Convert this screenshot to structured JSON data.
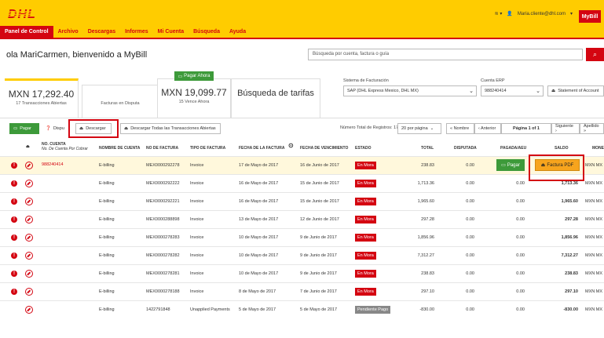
{
  "header": {
    "logo": "DHL",
    "user_email": "Maria.cliente@dhl.com",
    "mybill_label": "MyBill"
  },
  "nav": [
    "Panel de Control",
    "Archivo",
    "Descargas",
    "Informes",
    "Mi Cuenta",
    "Búsqueda",
    "Ayuda"
  ],
  "welcome": "ola MariCarmen, bienvenido a MyBill",
  "search": {
    "placeholder": "Búsqueda por cuenta, factura o guía"
  },
  "summary": {
    "open_amount": "MXN 17,292.40",
    "open_label": "17 Transacciones Abiertas",
    "disputed_label": "Facturas en Disputa",
    "due_amount": "MXN 19,099.77",
    "due_label": "15 Vence Ahora",
    "pay_now": "Pagar Ahora",
    "rates_search": "Búsqueda de tarifas"
  },
  "filters": {
    "billing_label": "Sistema de Facturación",
    "billing_value": "SAP (DHL Express Mexico, DHL MX)",
    "erp_label": "Cuenta ERP",
    "erp_value": "988240414",
    "statement": "Statement of Account"
  },
  "toolbar": {
    "pay": "Pagar",
    "dispute": "Dispu",
    "download": "Descargar",
    "download_all": "Descargar Todas las Transacciones Abiertas",
    "total_records": "Número Total de Registros: 17",
    "per_page": "20 por página",
    "first": "« Nombre",
    "prev": "‹ Anterior",
    "page": "Página 1 of 1",
    "next": "Siguiente ›",
    "last": "Apellido »"
  },
  "columns": {
    "account": "NO. CUENTA",
    "account_sub": "No. De Cuenta Por Cobrar",
    "client": "NOMBRE DE CUENTA",
    "invoice_no": "NO DE FACTURA",
    "invoice_type": "TIPO DE FACTURA",
    "invoice_date": "FECHA DE LA FACTURA",
    "due_date": "FECHA DE VENCIMIENTO",
    "status": "ESTADO",
    "total": "TOTAL",
    "disputed": "DISPUTADA",
    "paid": "PAGADA/AEU",
    "balance": "SALDO",
    "currency": "MONE"
  },
  "first_row_account": "988240414",
  "row_actions": {
    "pay": "Pagar",
    "pdf": "Factura PDF"
  },
  "rows": [
    {
      "client": "E-billing",
      "inv": "MEX0000292278",
      "type": "Invoice",
      "date": "17 de Mayo de 2017",
      "due": "16 de Junio de 2017",
      "status": "En Mora",
      "total": "238.83",
      "disp": "0.00",
      "paid": "0.00",
      "bal": "238.83",
      "cur": "MXN MX"
    },
    {
      "client": "E-billing",
      "inv": "MEX0000292222",
      "type": "Invoice",
      "date": "16 de Mayo de 2017",
      "due": "15 de Junio de 2017",
      "status": "En Mora",
      "total": "1,713.36",
      "disp": "0.00",
      "paid": "0.00",
      "bal": "1,713.36",
      "cur": "MXN MX"
    },
    {
      "client": "E-billing",
      "inv": "MEX0000292221",
      "type": "Invoice",
      "date": "16 de Mayo de 2017",
      "due": "15 de Junio de 2017",
      "status": "En Mora",
      "total": "1,965.60",
      "disp": "0.00",
      "paid": "0.00",
      "bal": "1,965.60",
      "cur": "MXN MX"
    },
    {
      "client": "E-billing",
      "inv": "MEX0000288898",
      "type": "Invoice",
      "date": "13 de Mayo de 2017",
      "due": "12 de Junio de 2017",
      "status": "En Mora",
      "total": "297.28",
      "disp": "0.00",
      "paid": "0.00",
      "bal": "297.28",
      "cur": "MXN MX"
    },
    {
      "client": "E-billing",
      "inv": "MEX0000278283",
      "type": "Invoice",
      "date": "10 de Mayo de 2017",
      "due": "9 de Junio de 2017",
      "status": "En Mora",
      "total": "1,856.96",
      "disp": "0.00",
      "paid": "0.00",
      "bal": "1,856.96",
      "cur": "MXN MX"
    },
    {
      "client": "E-billing",
      "inv": "MEX0000278282",
      "type": "Invoice",
      "date": "10 de Mayo de 2017",
      "due": "9 de Junio de 2017",
      "status": "En Mora",
      "total": "7,312.27",
      "disp": "0.00",
      "paid": "0.00",
      "bal": "7,312.27",
      "cur": "MXN MX"
    },
    {
      "client": "E-billing",
      "inv": "MEX0000278281",
      "type": "Invoice",
      "date": "10 de Mayo de 2017",
      "due": "9 de Junio de 2017",
      "status": "En Mora",
      "total": "238.83",
      "disp": "0.00",
      "paid": "0.00",
      "bal": "238.83",
      "cur": "MXN MX"
    },
    {
      "client": "E-billing",
      "inv": "MEX0000278188",
      "type": "Invoice",
      "date": "8 de Mayo de 2017",
      "due": "7 de Junio de 2017",
      "status": "En Mora",
      "total": "297.10",
      "disp": "0.00",
      "paid": "0.00",
      "bal": "297.10",
      "cur": "MXN MX"
    },
    {
      "client": "E-billing",
      "inv": "1422791848",
      "type": "Unapplied Payments",
      "date": "5 de Mayo de 2017",
      "due": "5 de Mayo de 2017",
      "status": "Pendiente Pago",
      "total": "-830.00",
      "disp": "0.00",
      "paid": "0.00",
      "bal": "-830.00",
      "cur": "MXN MX"
    }
  ]
}
